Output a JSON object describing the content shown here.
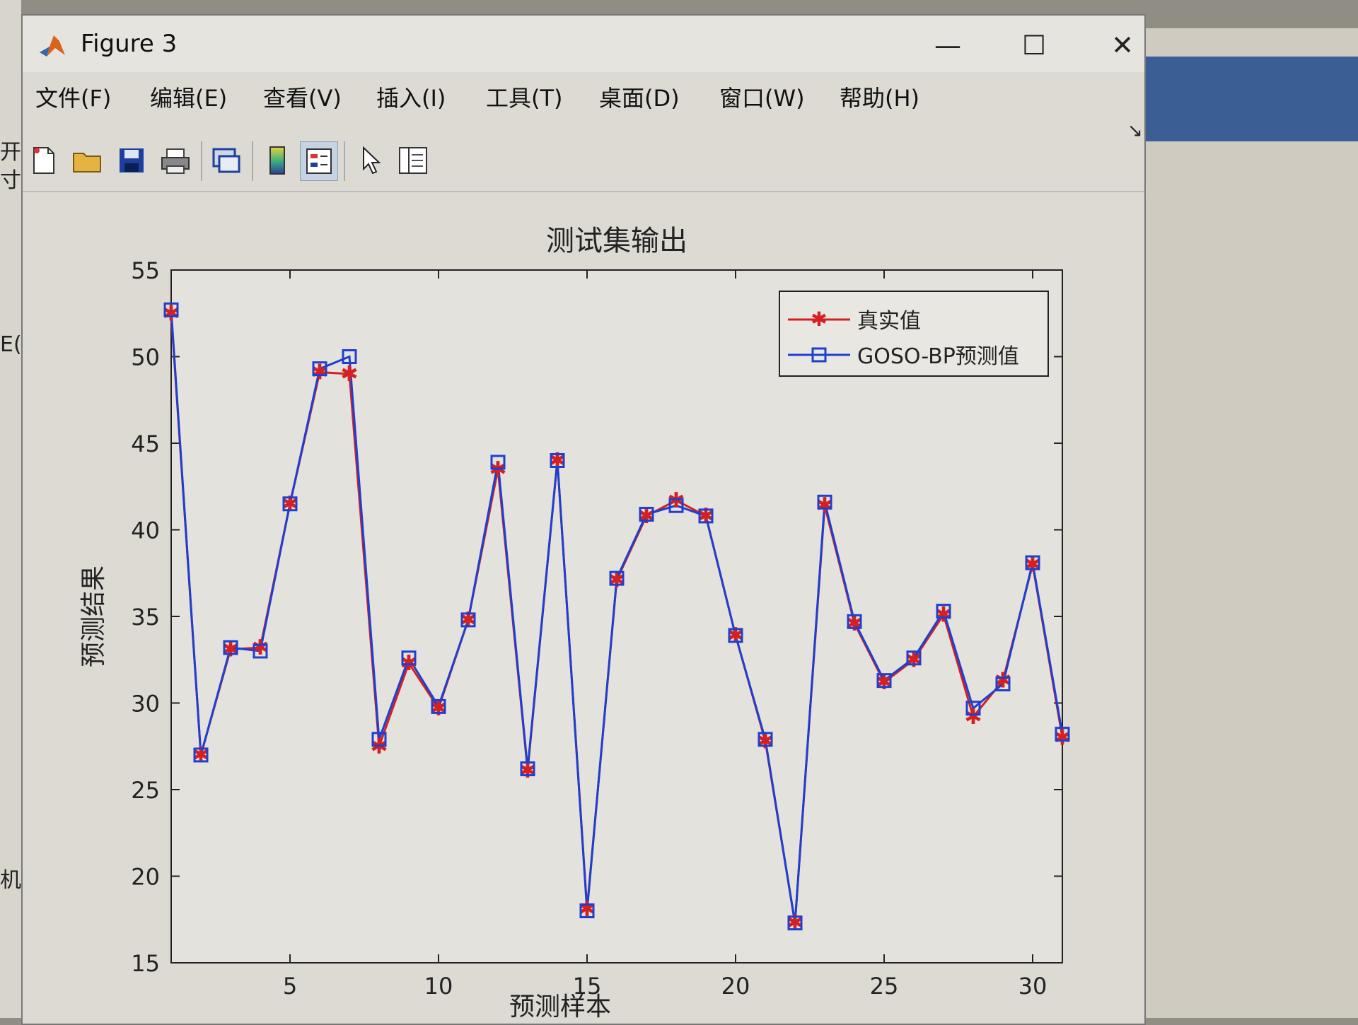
{
  "window": {
    "title": "Figure 3",
    "minimize_label": "—",
    "maximize_label": "☐",
    "close_label": "✕"
  },
  "menu": [
    "文件(F)",
    "编辑(E)",
    "查看(V)",
    "插入(I)",
    "工具(T)",
    "桌面(D)",
    "窗口(W)",
    "帮助(H)"
  ],
  "toolbar": [
    "new-figure-icon",
    "open-file-icon",
    "save-icon",
    "print-icon",
    "link-plot-icon",
    "colorbar-icon",
    "legend-icon",
    "pointer-icon",
    "property-inspector-icon"
  ],
  "desktop_left_fragments": [
    "开",
    "寸",
    "E(",
    "机"
  ],
  "colors": {
    "true_series": "#d42020",
    "pred_series": "#1f3fd0"
  },
  "chart_data": {
    "type": "line",
    "title": "测试集输出",
    "xlabel": "预测样本",
    "ylabel": "预测结果",
    "xlim": [
      1,
      31
    ],
    "ylim": [
      15,
      55
    ],
    "xticks": [
      5,
      10,
      15,
      20,
      25,
      30
    ],
    "yticks": [
      15,
      20,
      25,
      30,
      35,
      40,
      45,
      50,
      55
    ],
    "legend_position": "top-right",
    "x": [
      1,
      2,
      3,
      4,
      5,
      6,
      7,
      8,
      9,
      10,
      11,
      12,
      13,
      14,
      15,
      16,
      17,
      18,
      19,
      20,
      21,
      22,
      23,
      24,
      25,
      26,
      27,
      28,
      29,
      30,
      31
    ],
    "series": [
      {
        "name": "真实值",
        "marker": "star",
        "values": [
          52.5,
          27.0,
          33.1,
          33.2,
          41.5,
          49.1,
          49.0,
          27.5,
          32.3,
          29.7,
          34.8,
          43.5,
          26.1,
          44.0,
          18.1,
          37.1,
          40.8,
          41.7,
          40.8,
          33.9,
          27.8,
          17.3,
          41.4,
          34.6,
          31.2,
          32.5,
          35.1,
          29.2,
          31.3,
          38.0,
          28.0
        ]
      },
      {
        "name": "GOSO-BP预测值",
        "marker": "square",
        "values": [
          52.7,
          27.0,
          33.2,
          33.0,
          41.5,
          49.3,
          50.0,
          27.9,
          32.6,
          29.8,
          34.8,
          43.9,
          26.2,
          44.0,
          18.0,
          37.2,
          40.9,
          41.4,
          40.8,
          33.9,
          27.9,
          17.3,
          41.6,
          34.7,
          31.3,
          32.6,
          35.3,
          29.7,
          31.1,
          38.1,
          28.2
        ]
      }
    ]
  }
}
